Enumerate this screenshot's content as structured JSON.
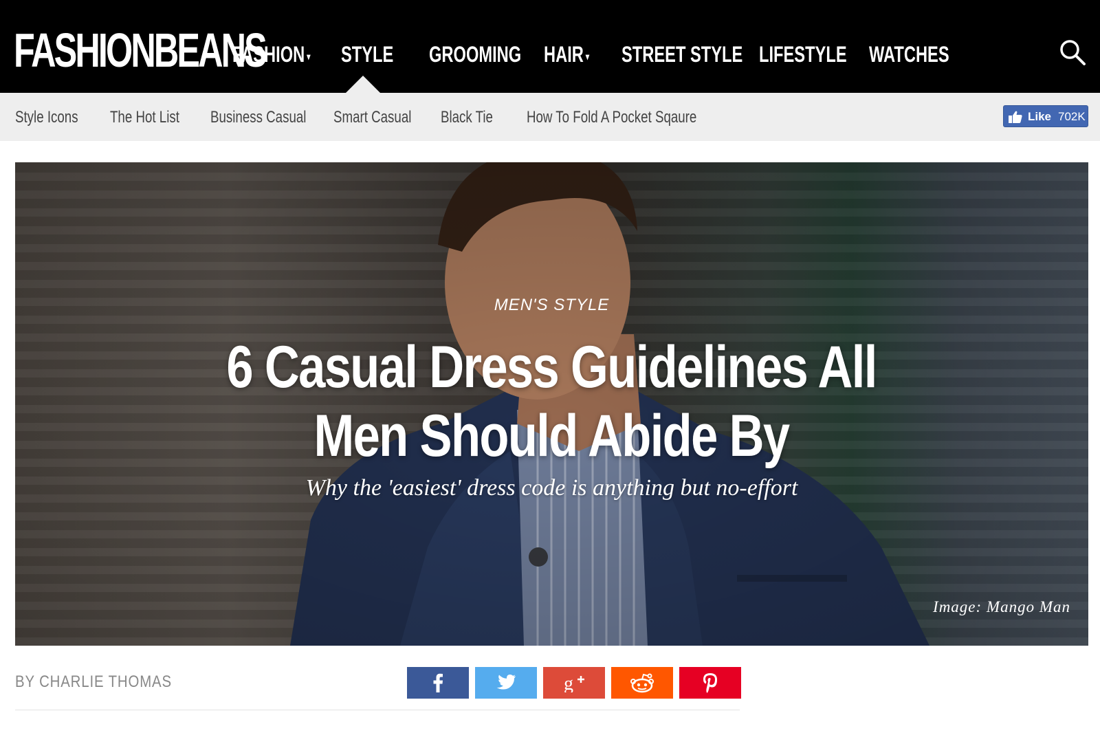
{
  "header": {
    "logo": "FASHIONBEANS",
    "nav": [
      {
        "label": "FASHION",
        "has_dropdown": true
      },
      {
        "label": "STYLE",
        "has_dropdown": false,
        "active": true
      },
      {
        "label": "GROOMING",
        "has_dropdown": false
      },
      {
        "label": "HAIR",
        "has_dropdown": true
      },
      {
        "label": "STREET STYLE",
        "has_dropdown": false
      },
      {
        "label": "LIFESTYLE",
        "has_dropdown": false
      },
      {
        "label": "WATCHES",
        "has_dropdown": false
      }
    ],
    "dropdown_glyph": "▾",
    "search_icon": "search-icon"
  },
  "subnav": {
    "items": [
      "Style Icons",
      "The Hot List",
      "Business Casual",
      "Smart Casual",
      "Black Tie",
      "How To Fold A Pocket Sqaure"
    ],
    "fb_like": {
      "label": "Like",
      "count": "702K"
    }
  },
  "hero": {
    "category": "MEN'S STYLE",
    "title": "6 Casual Dress Guidelines All Men Should Abide By",
    "subtitle": "Why the 'easiest' dress code is anything but no-effort",
    "credit": "Image: Mango Man"
  },
  "article": {
    "byline": "BY CHARLIE THOMAS"
  },
  "share": [
    {
      "network": "facebook",
      "color": "#3b5998"
    },
    {
      "network": "twitter",
      "color": "#55acee"
    },
    {
      "network": "google-plus",
      "color": "#dd4b39"
    },
    {
      "network": "reddit",
      "color": "#ff5700"
    },
    {
      "network": "pinterest",
      "color": "#e60023"
    }
  ],
  "colors": {
    "header_bg": "#000000",
    "subnav_bg": "#eeeeee",
    "facebook_blue": "#4267b2"
  }
}
